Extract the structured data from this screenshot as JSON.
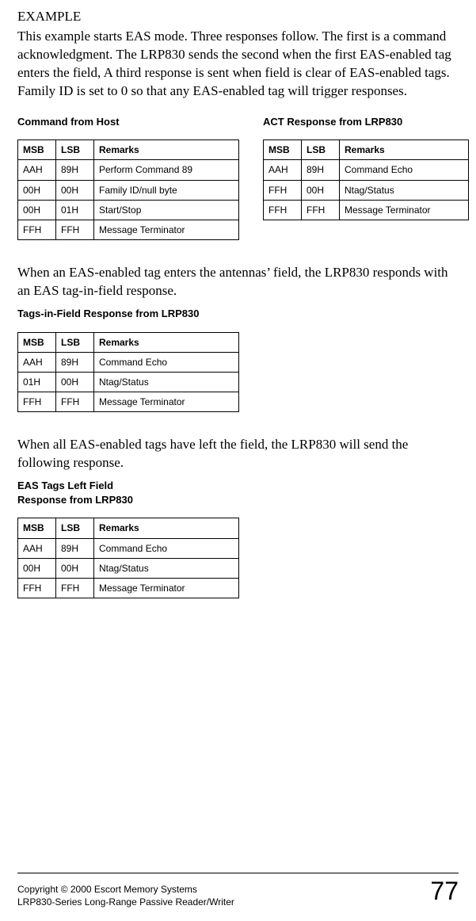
{
  "exampleLabel": "EXAMPLE",
  "paragraph1": "This example starts EAS mode. Three responses follow. The first is a command acknowledgment. The LRP830 sends the second when the first EAS-enabled tag enters the field, A third response is sent when field is clear of EAS-enabled tags. Family ID is set to 0 so that any EAS-enabled tag will trigger responses.",
  "table1": {
    "title": "Command from Host",
    "headers": {
      "msb": "MSB",
      "lsb": "LSB",
      "remarks": "Remarks"
    },
    "rows": [
      {
        "msb": "AAH",
        "lsb": "89H",
        "remarks": "Perform Command 89"
      },
      {
        "msb": "00H",
        "lsb": "00H",
        "remarks": "Family ID/null byte"
      },
      {
        "msb": "00H",
        "lsb": "01H",
        "remarks": "Start/Stop"
      },
      {
        "msb": "FFH",
        "lsb": "FFH",
        "remarks": "Message Terminator"
      }
    ]
  },
  "table2": {
    "title": "ACT Response from LRP830",
    "headers": {
      "msb": "MSB",
      "lsb": "LSB",
      "remarks": "Remarks"
    },
    "rows": [
      {
        "msb": "AAH",
        "lsb": "89H",
        "remarks": "Command Echo"
      },
      {
        "msb": "FFH",
        "lsb": "00H",
        "remarks": "Ntag/Status"
      },
      {
        "msb": "FFH",
        "lsb": "FFH",
        "remarks": "Message Terminator"
      }
    ]
  },
  "paragraph2": "When an EAS-enabled tag enters the antennas’ field, the LRP830 responds with an EAS tag-in-field response.",
  "table3": {
    "title": "Tags-in-Field Response from LRP830",
    "headers": {
      "msb": "MSB",
      "lsb": "LSB",
      "remarks": "Remarks"
    },
    "rows": [
      {
        "msb": "AAH",
        "lsb": "89H",
        "remarks": "Command Echo"
      },
      {
        "msb": "01H",
        "lsb": "00H",
        "remarks": "Ntag/Status"
      },
      {
        "msb": "FFH",
        "lsb": "FFH",
        "remarks": "Message Terminator"
      }
    ]
  },
  "paragraph3": "When all EAS-enabled tags have left the field, the LRP830 will send the following response.",
  "table4": {
    "titleLine1": "EAS Tags Left Field",
    "titleLine2": "Response from LRP830",
    "headers": {
      "msb": "MSB",
      "lsb": "LSB",
      "remarks": "Remarks"
    },
    "rows": [
      {
        "msb": "AAH",
        "lsb": "89H",
        "remarks": "Command Echo"
      },
      {
        "msb": "00H",
        "lsb": "00H",
        "remarks": "Ntag/Status"
      },
      {
        "msb": "FFH",
        "lsb": "FFH",
        "remarks": "Message Terminator"
      }
    ]
  },
  "footer": {
    "line1": "Copyright © 2000 Escort Memory Systems",
    "line2": "LRP830-Series Long-Range Passive Reader/Writer",
    "pageNumber": "77"
  }
}
